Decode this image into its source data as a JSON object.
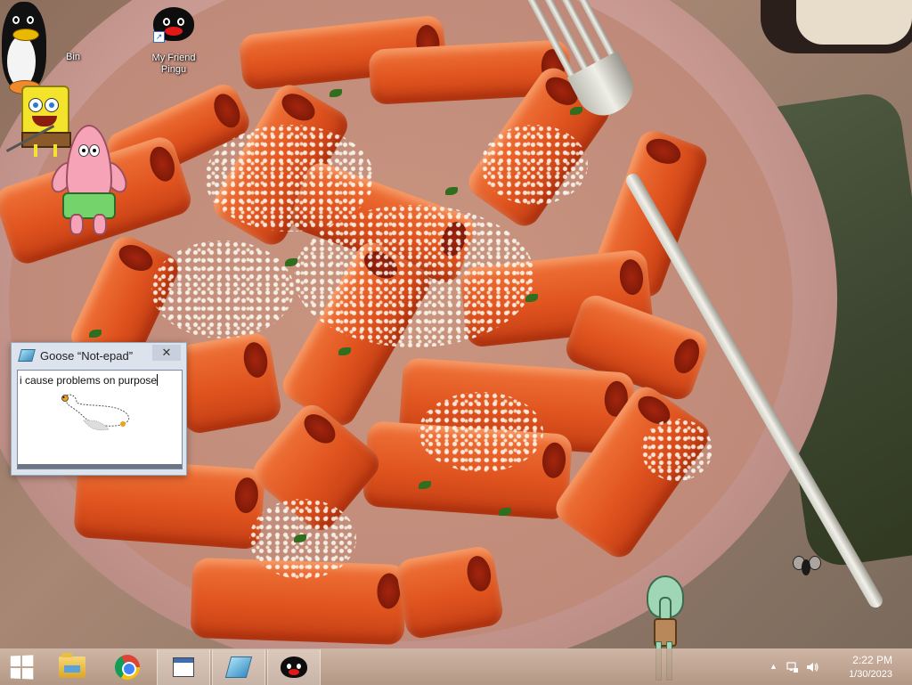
{
  "desktop": {
    "icons": [
      {
        "label": "Bin"
      },
      {
        "label_line1": "My Friend",
        "label_line2": "Pingu"
      }
    ],
    "wallpaper": "pasta-rigatoni-photo",
    "pets": [
      "pingu-pet",
      "spongebob-pet",
      "patrick-pet",
      "squidward-pet",
      "fly-pet"
    ]
  },
  "notepad_window": {
    "title": "Goose “Not-epad”",
    "close_symbol": "✕",
    "text": "i cause problems on purpose",
    "icon": "notepad-icon",
    "drawing": "goose-drawing"
  },
  "taskbar": {
    "start_icon": "windows-start-icon",
    "pinned": [
      "file-explorer-icon",
      "chrome-icon",
      "window-icon",
      "notepad-icon",
      "pingu-icon"
    ],
    "tray": {
      "show_hidden_symbol": "▲",
      "network_icon": "network-icon",
      "volume_icon": "volume-icon"
    },
    "clock": {
      "time": "2:22 PM",
      "date": "1/30/2023"
    }
  },
  "colors": {
    "taskbar": "#b99a86",
    "goose_window": "#dce3ec",
    "pasta": "#e0541f"
  }
}
